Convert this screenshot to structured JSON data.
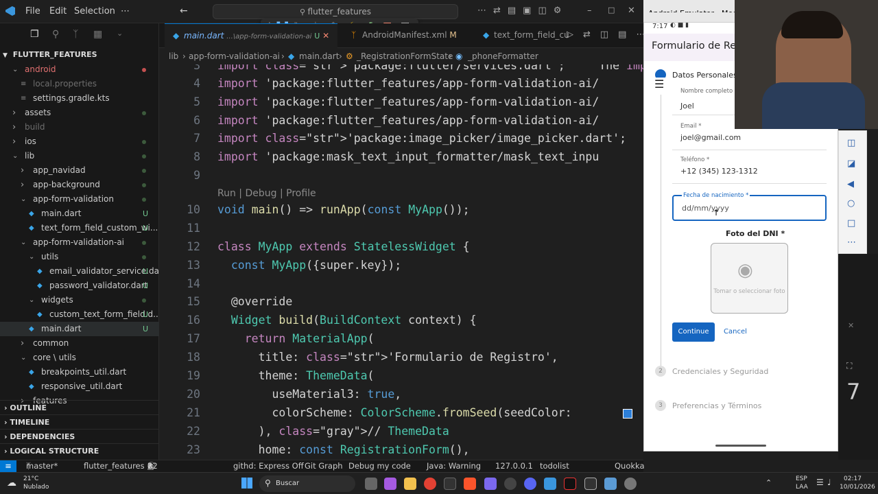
{
  "titlebar": {
    "menus": [
      "File",
      "Edit",
      "Selection",
      "⋯"
    ],
    "search": "flutter_features"
  },
  "explorer": {
    "title": "FLUTTER_FEATURES",
    "items": [
      {
        "label": "android",
        "indent": 1,
        "kind": "folder-open",
        "color": "#e07070",
        "dot": "#c45050"
      },
      {
        "label": "local.properties",
        "indent": 2,
        "kind": "file",
        "color": "#6e6e6e"
      },
      {
        "label": "settings.gradle.kts",
        "indent": 2,
        "kind": "file",
        "color": "#ccc"
      },
      {
        "label": "assets",
        "indent": 1,
        "kind": "folder",
        "color": "#ccc",
        "dot": "#3c5a3c"
      },
      {
        "label": "build",
        "indent": 1,
        "kind": "folder",
        "color": "#6e6e6e"
      },
      {
        "label": "ios",
        "indent": 1,
        "kind": "folder",
        "color": "#ccc",
        "dot": "#3c5a3c"
      },
      {
        "label": "lib",
        "indent": 1,
        "kind": "folder-open",
        "color": "#ccc",
        "dot": "#3c5a3c"
      },
      {
        "label": "app_navidad",
        "indent": 2,
        "kind": "folder",
        "color": "#ccc",
        "dot": "#3c5a3c"
      },
      {
        "label": "app-background",
        "indent": 2,
        "kind": "folder",
        "color": "#ccc",
        "dot": "#3c5a3c"
      },
      {
        "label": "app-form-validation",
        "indent": 2,
        "kind": "folder-open",
        "color": "#ccc",
        "dot": "#3c5a3c"
      },
      {
        "label": "main.dart",
        "indent": 3,
        "kind": "dart",
        "color": "#ccc",
        "badge": "U"
      },
      {
        "label": "text_form_field_custom_wi...",
        "indent": 3,
        "kind": "dart",
        "color": "#ccc",
        "badge": "U"
      },
      {
        "label": "app-form-validation-ai",
        "indent": 2,
        "kind": "folder-open",
        "color": "#ccc",
        "dot": "#3c5a3c"
      },
      {
        "label": "utils",
        "indent": 3,
        "kind": "folder-open",
        "color": "#ccc",
        "dot": "#3c5a3c"
      },
      {
        "label": "email_validator_service.dart",
        "indent": 4,
        "kind": "dart",
        "color": "#ccc",
        "badge": "U"
      },
      {
        "label": "password_validator.dart",
        "indent": 4,
        "kind": "dart",
        "color": "#ccc",
        "badge": "U"
      },
      {
        "label": "widgets",
        "indent": 3,
        "kind": "folder-open",
        "color": "#ccc",
        "dot": "#3c5a3c"
      },
      {
        "label": "custom_text_form_field.d...",
        "indent": 4,
        "kind": "dart",
        "color": "#ccc",
        "badge": "U"
      },
      {
        "label": "main.dart",
        "indent": 3,
        "kind": "dart",
        "color": "#ccc",
        "badge": "U",
        "selected": true
      },
      {
        "label": "common",
        "indent": 2,
        "kind": "folder",
        "color": "#ccc"
      },
      {
        "label": "core \\ utils",
        "indent": 2,
        "kind": "folder-open",
        "color": "#ccc"
      },
      {
        "label": "breakpoints_util.dart",
        "indent": 3,
        "kind": "dart",
        "color": "#ccc"
      },
      {
        "label": "responsive_util.dart",
        "indent": 3,
        "kind": "dart",
        "color": "#ccc"
      },
      {
        "label": "features",
        "indent": 2,
        "kind": "folder",
        "color": "#ccc"
      }
    ],
    "sections": [
      "OUTLINE",
      "TIMELINE",
      "DEPENDENCIES",
      "LOGICAL STRUCTURE"
    ]
  },
  "tabs": [
    {
      "label": "main.dart",
      "path": "...\\app-form-validation-ai",
      "badge": "U",
      "active": true
    },
    {
      "label": "AndroidManifest.xml",
      "badge": "M",
      "active": false
    },
    {
      "label": "text_form_field_cu",
      "active": false
    }
  ],
  "breadcrumbs": [
    "lib",
    "app-form-validation-ai",
    "main.dart",
    "_RegistrationFormState",
    "_phoneFormatter"
  ],
  "code": {
    "codelens": "Run | Debug | Profile",
    "lines": [
      {
        "n": "3",
        "t": "import 'package:flutter/services.dart';     The import o"
      },
      {
        "n": "4",
        "t": "import 'package:flutter_features/app-form-validation-ai/"
      },
      {
        "n": "5",
        "t": "import 'package:flutter_features/app-form-validation-ai/"
      },
      {
        "n": "6",
        "t": "import 'package:flutter_features/app-form-validation-ai/"
      },
      {
        "n": "7",
        "t": "import 'package:image_picker/image_picker.dart';"
      },
      {
        "n": "8",
        "t": "import 'package:mask_text_input_formatter/mask_text_inpu"
      },
      {
        "n": "9",
        "t": ""
      },
      {
        "n": "10",
        "t": "void main() => runApp(const MyApp());"
      },
      {
        "n": "11",
        "t": ""
      },
      {
        "n": "12",
        "t": "class MyApp extends StatelessWidget {"
      },
      {
        "n": "13",
        "t": "  const MyApp({super.key});"
      },
      {
        "n": "14",
        "t": ""
      },
      {
        "n": "15",
        "t": "  @override"
      },
      {
        "n": "16",
        "t": "  Widget build(BuildContext context) {"
      },
      {
        "n": "17",
        "t": "    return MaterialApp("
      },
      {
        "n": "18",
        "t": "      title: 'Formulario de Registro',"
      },
      {
        "n": "19",
        "t": "      theme: ThemeData("
      },
      {
        "n": "20",
        "t": "        useMaterial3: true,"
      },
      {
        "n": "21",
        "t": "        colorScheme: ColorScheme.fromSeed(seedColor: "
      },
      {
        "n": "22",
        "t": "      ), // ThemeData"
      },
      {
        "n": "23",
        "t": "      home: const RegistrationForm(),"
      }
    ]
  },
  "statusbar": {
    "branch": "master*",
    "project": "flutter_features",
    "errors": "1",
    "warnings": "8",
    "infos": "22",
    "githd": "githd: Express Off",
    "gitgraph": "Git Graph",
    "debug": "Debug my code",
    "java": "Java: Warning",
    "server": "127.0.0.1",
    "todolist": "todolist",
    "quokka": "Quokka"
  },
  "emulator": {
    "window_title": "Android Emulator - Medium_Phone",
    "phone_time": "7:17",
    "app_title": "Formulario de Reg",
    "step1": "Datos Personales",
    "fields": [
      {
        "label": "Nombre completo",
        "value": "Joel"
      },
      {
        "label": "Email *",
        "value": "joel@gmail.com"
      },
      {
        "label": "Teléfono *",
        "value": "+12 (345) 123-1312"
      },
      {
        "label": "Fecha de nacimiento *",
        "value": "dd/mm/yyyy"
      }
    ],
    "photo_title": "Foto del DNI *",
    "photo_hint": "Tomar o seleccionar foto",
    "continue": "Continue",
    "cancel": "Cancel",
    "step2_num": "2",
    "step2": "Credenciales y Seguridad",
    "step3_num": "3",
    "step3": "Preferencias y Términos",
    "accent": "#1565c0"
  },
  "taskbar": {
    "weather_temp": "21°C",
    "weather_desc": "Nublado",
    "search": "Buscar",
    "lang1": "ESP",
    "lang2": "LAA",
    "time": "02:17",
    "date": "10/01/2026"
  },
  "background_digit": "7"
}
